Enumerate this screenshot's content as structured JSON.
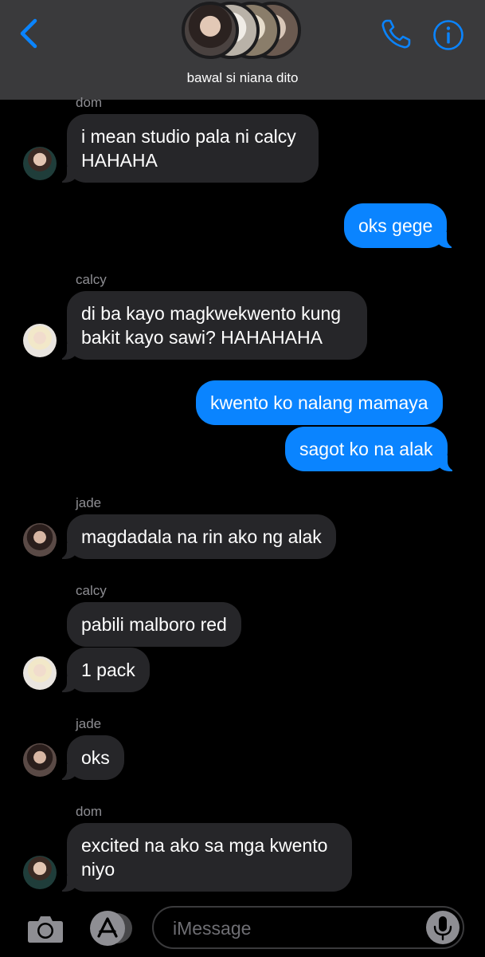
{
  "header": {
    "group_name": "bawal si niana dito",
    "icons": {
      "back": "chevron-left-icon",
      "call": "phone-icon",
      "info": "info-icon"
    },
    "accent_color": "#0a84ff"
  },
  "messages": [
    {
      "type": "sender",
      "text": "dom"
    },
    {
      "type": "in",
      "text": "i mean studio pala ni calcy HAHAHA",
      "avatar": "dom"
    },
    {
      "type": "out",
      "text": "oks gege"
    },
    {
      "type": "sender",
      "text": "calcy"
    },
    {
      "type": "in",
      "text": "di ba kayo magkwekwento kung bakit kayo sawi? HAHAHAHA",
      "avatar": "calcy"
    },
    {
      "type": "out",
      "text": "kwento ko nalang mamaya"
    },
    {
      "type": "out",
      "text": "sagot ko na alak"
    },
    {
      "type": "sender",
      "text": "jade"
    },
    {
      "type": "in",
      "text": "magdadala na rin ako ng alak",
      "avatar": "jade"
    },
    {
      "type": "sender",
      "text": "calcy"
    },
    {
      "type": "in",
      "text": "pabili malboro red"
    },
    {
      "type": "in",
      "text": "1 pack",
      "avatar": "calcy"
    },
    {
      "type": "sender",
      "text": "jade"
    },
    {
      "type": "in",
      "text": "oks",
      "avatar": "jade"
    },
    {
      "type": "sender",
      "text": "dom"
    },
    {
      "type": "in",
      "text": "excited na ako sa mga kwento niyo",
      "avatar": "dom"
    }
  ],
  "composer": {
    "placeholder": "iMessage",
    "icons": {
      "camera": "camera-icon",
      "apps": "app-store-icon",
      "mic": "microphone-icon"
    }
  }
}
